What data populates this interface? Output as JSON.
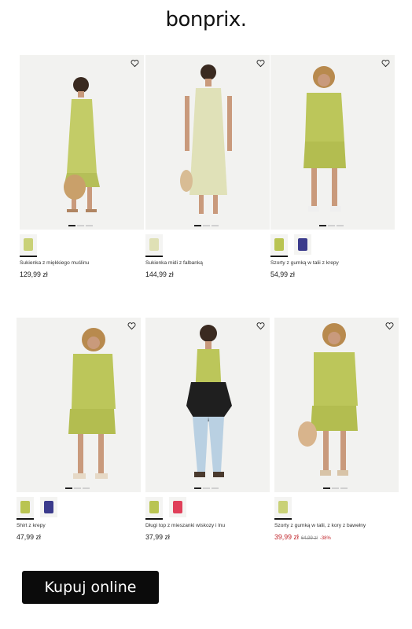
{
  "brand": {
    "logo_text": "bonprix."
  },
  "products": [
    {
      "name": "Sukienka z miękkiego muślinu",
      "price": "129,99 zł",
      "old_price": "",
      "discount": "",
      "swatches": [
        "#c9d177"
      ],
      "selected": 0,
      "dots": 3
    },
    {
      "name": "Sukienka midi z falbanką",
      "price": "144,99 zł",
      "old_price": "",
      "discount": "",
      "swatches": [
        "#dfe0b5"
      ],
      "selected": 0,
      "dots": 3
    },
    {
      "name": "Szorty z gumką w talii z krepy",
      "price": "54,99 zł",
      "old_price": "",
      "discount": "",
      "swatches": [
        "#b9c452",
        "#3b3b8c"
      ],
      "selected": 0,
      "dots": 3
    },
    {
      "name": "Shirt z krepy",
      "price": "47,99 zł",
      "old_price": "",
      "discount": "",
      "swatches": [
        "#b9c452",
        "#3b3b8c"
      ],
      "selected": 0,
      "dots": 3
    },
    {
      "name": "Długi top z mieszanki wiskozy i lnu",
      "price": "37,99 zł",
      "old_price": "",
      "discount": "",
      "swatches": [
        "#b9c452",
        "#e0405a"
      ],
      "selected": 0,
      "dots": 3
    },
    {
      "name": "Szorty z gumką w talii, z kory z bawełny",
      "price": "39,99 zł",
      "old_price": "64,99 zł",
      "discount": "-38%",
      "swatches": [
        "#c9d177"
      ],
      "selected": 0,
      "dots": 3
    }
  ],
  "cta": {
    "label": "Kupuj online"
  },
  "colors": {
    "accent": "#0b0b0b",
    "sale": "#c1272d",
    "garment": "#bcc65a"
  }
}
